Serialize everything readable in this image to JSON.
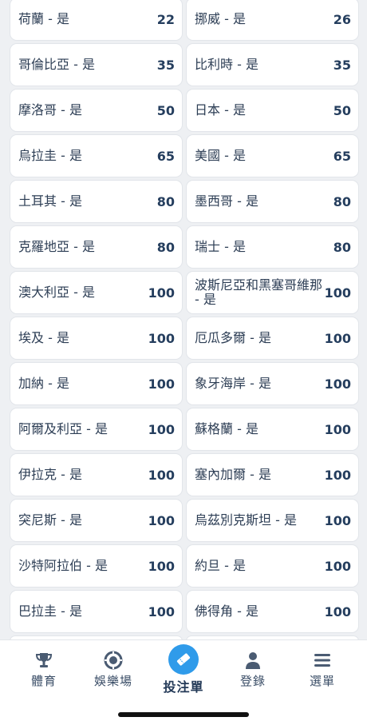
{
  "rows": [
    [
      {
        "label": "荷蘭 - 是",
        "odds": "22"
      },
      {
        "label": "挪威 - 是",
        "odds": "26"
      }
    ],
    [
      {
        "label": "哥倫比亞 - 是",
        "odds": "35"
      },
      {
        "label": "比利時 - 是",
        "odds": "35"
      }
    ],
    [
      {
        "label": "摩洛哥 - 是",
        "odds": "50"
      },
      {
        "label": "日本 - 是",
        "odds": "50"
      }
    ],
    [
      {
        "label": "烏拉圭 - 是",
        "odds": "65"
      },
      {
        "label": "美國 - 是",
        "odds": "65"
      }
    ],
    [
      {
        "label": "土耳其 - 是",
        "odds": "80"
      },
      {
        "label": "墨西哥 - 是",
        "odds": "80"
      }
    ],
    [
      {
        "label": "克羅地亞 - 是",
        "odds": "80"
      },
      {
        "label": "瑞士 - 是",
        "odds": "80"
      }
    ],
    [
      {
        "label": "澳大利亞 - 是",
        "odds": "100"
      },
      {
        "label": "波斯尼亞和黑塞哥維那 - 是",
        "odds": "100"
      }
    ],
    [
      {
        "label": "埃及 - 是",
        "odds": "100"
      },
      {
        "label": "厄瓜多爾 - 是",
        "odds": "100"
      }
    ],
    [
      {
        "label": "加納 - 是",
        "odds": "100"
      },
      {
        "label": "象牙海岸 - 是",
        "odds": "100"
      }
    ],
    [
      {
        "label": "阿爾及利亞 - 是",
        "odds": "100"
      },
      {
        "label": "蘇格蘭 - 是",
        "odds": "100"
      }
    ],
    [
      {
        "label": "伊拉克 - 是",
        "odds": "100"
      },
      {
        "label": "塞內加爾 - 是",
        "odds": "100"
      }
    ],
    [
      {
        "label": "突尼斯 - 是",
        "odds": "100"
      },
      {
        "label": "烏茲別克斯坦 - 是",
        "odds": "100"
      }
    ],
    [
      {
        "label": "沙特阿拉伯 - 是",
        "odds": "100"
      },
      {
        "label": "約旦 - 是",
        "odds": "100"
      }
    ],
    [
      {
        "label": "巴拉圭 - 是",
        "odds": "100"
      },
      {
        "label": "佛得角 - 是",
        "odds": "100"
      }
    ]
  ],
  "nav": {
    "sports": {
      "label": "體育",
      "icon": "trophy-icon"
    },
    "casino": {
      "label": "娛樂場",
      "icon": "casino-chip-icon"
    },
    "betslip": {
      "label": "投注單",
      "icon": "ticket-icon",
      "active": true
    },
    "login": {
      "label": "登錄",
      "icon": "user-icon"
    },
    "menu": {
      "label": "選單",
      "icon": "hamburger-menu-icon"
    }
  },
  "colors": {
    "accent": "#2f9bea",
    "text": "#2d3e55",
    "odds": "#253e5e",
    "nav_text": "#3c4f68"
  }
}
